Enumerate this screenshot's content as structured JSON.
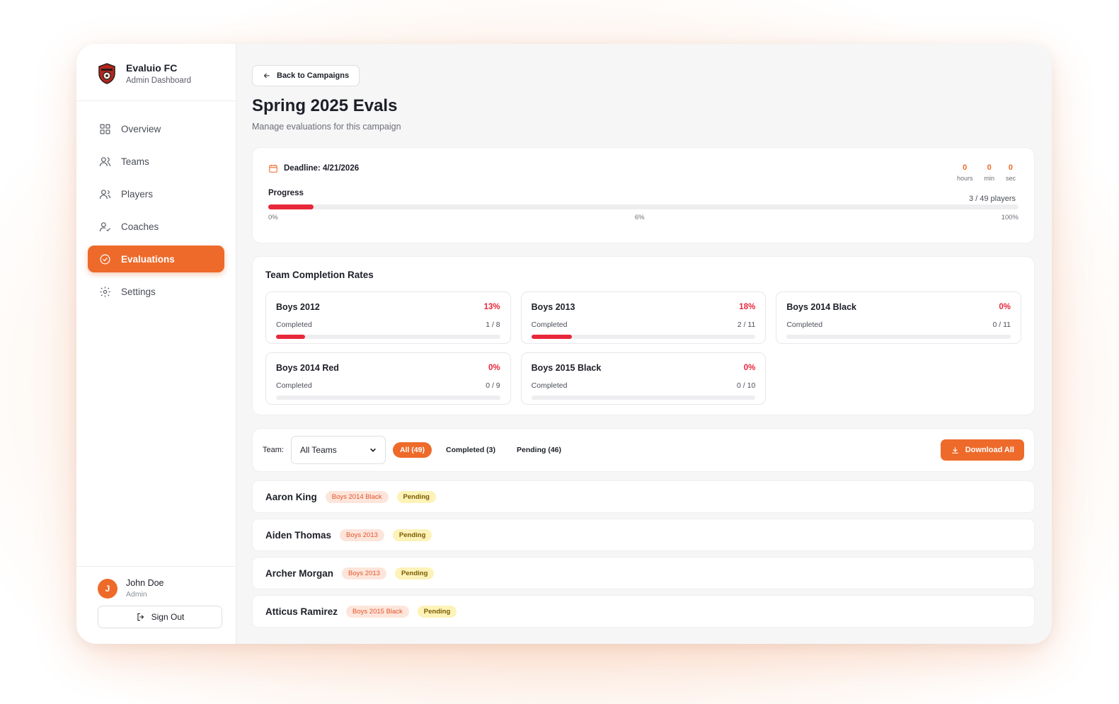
{
  "brand": {
    "name": "Evaluio FC",
    "subtitle": "Admin Dashboard",
    "accent": "#ee6a2a"
  },
  "nav": [
    {
      "label": "Overview",
      "icon": "grid-icon",
      "active": false
    },
    {
      "label": "Teams",
      "icon": "users-icon",
      "active": false
    },
    {
      "label": "Players",
      "icon": "user-group-icon",
      "active": false
    },
    {
      "label": "Coaches",
      "icon": "user-check-icon",
      "active": false
    },
    {
      "label": "Evaluations",
      "icon": "check-circle-icon",
      "active": true
    },
    {
      "label": "Settings",
      "icon": "gear-icon",
      "active": false
    }
  ],
  "user": {
    "initial": "J",
    "name": "John Doe",
    "role": "Admin",
    "signout_label": "Sign Out"
  },
  "header": {
    "back_label": "Back to Campaigns",
    "title": "Spring 2025 Evals",
    "subtitle": "Manage evaluations for this campaign"
  },
  "deadline": {
    "label": "Deadline: 4/21/2026",
    "countdown": [
      {
        "value": "0",
        "unit": "hours"
      },
      {
        "value": "0",
        "unit": "min"
      },
      {
        "value": "0",
        "unit": "sec"
      }
    ],
    "progress_label": "Progress",
    "progress_percent": 6,
    "progress_text": "6%",
    "players_text": "3 / 49 players",
    "scale_start": "0%",
    "scale_end": "100%"
  },
  "team_rates": {
    "title": "Team Completion Rates",
    "completed_label": "Completed",
    "teams": [
      {
        "name": "Boys 2012",
        "percent": 13,
        "percent_text": "13%",
        "count": "1 / 8"
      },
      {
        "name": "Boys 2013",
        "percent": 18,
        "percent_text": "18%",
        "count": "2 / 11"
      },
      {
        "name": "Boys 2014 Black",
        "percent": 0,
        "percent_text": "0%",
        "count": "0 / 11"
      },
      {
        "name": "Boys 2014 Red",
        "percent": 0,
        "percent_text": "0%",
        "count": "0 / 9"
      },
      {
        "name": "Boys 2015 Black",
        "percent": 0,
        "percent_text": "0%",
        "count": "0 / 10"
      }
    ]
  },
  "filters": {
    "team_label": "Team:",
    "team_value": "All Teams",
    "pills": [
      {
        "label": "All (49)",
        "active": true
      },
      {
        "label": "Completed (3)",
        "active": false
      },
      {
        "label": "Pending (46)",
        "active": false
      }
    ],
    "download_label": "Download All"
  },
  "players": [
    {
      "name": "Aaron King",
      "team": "Boys 2014 Black",
      "status": "Pending"
    },
    {
      "name": "Aiden Thomas",
      "team": "Boys 2013",
      "status": "Pending"
    },
    {
      "name": "Archer Morgan",
      "team": "Boys 2013",
      "status": "Pending"
    },
    {
      "name": "Atticus Ramirez",
      "team": "Boys 2015 Black",
      "status": "Pending"
    }
  ]
}
